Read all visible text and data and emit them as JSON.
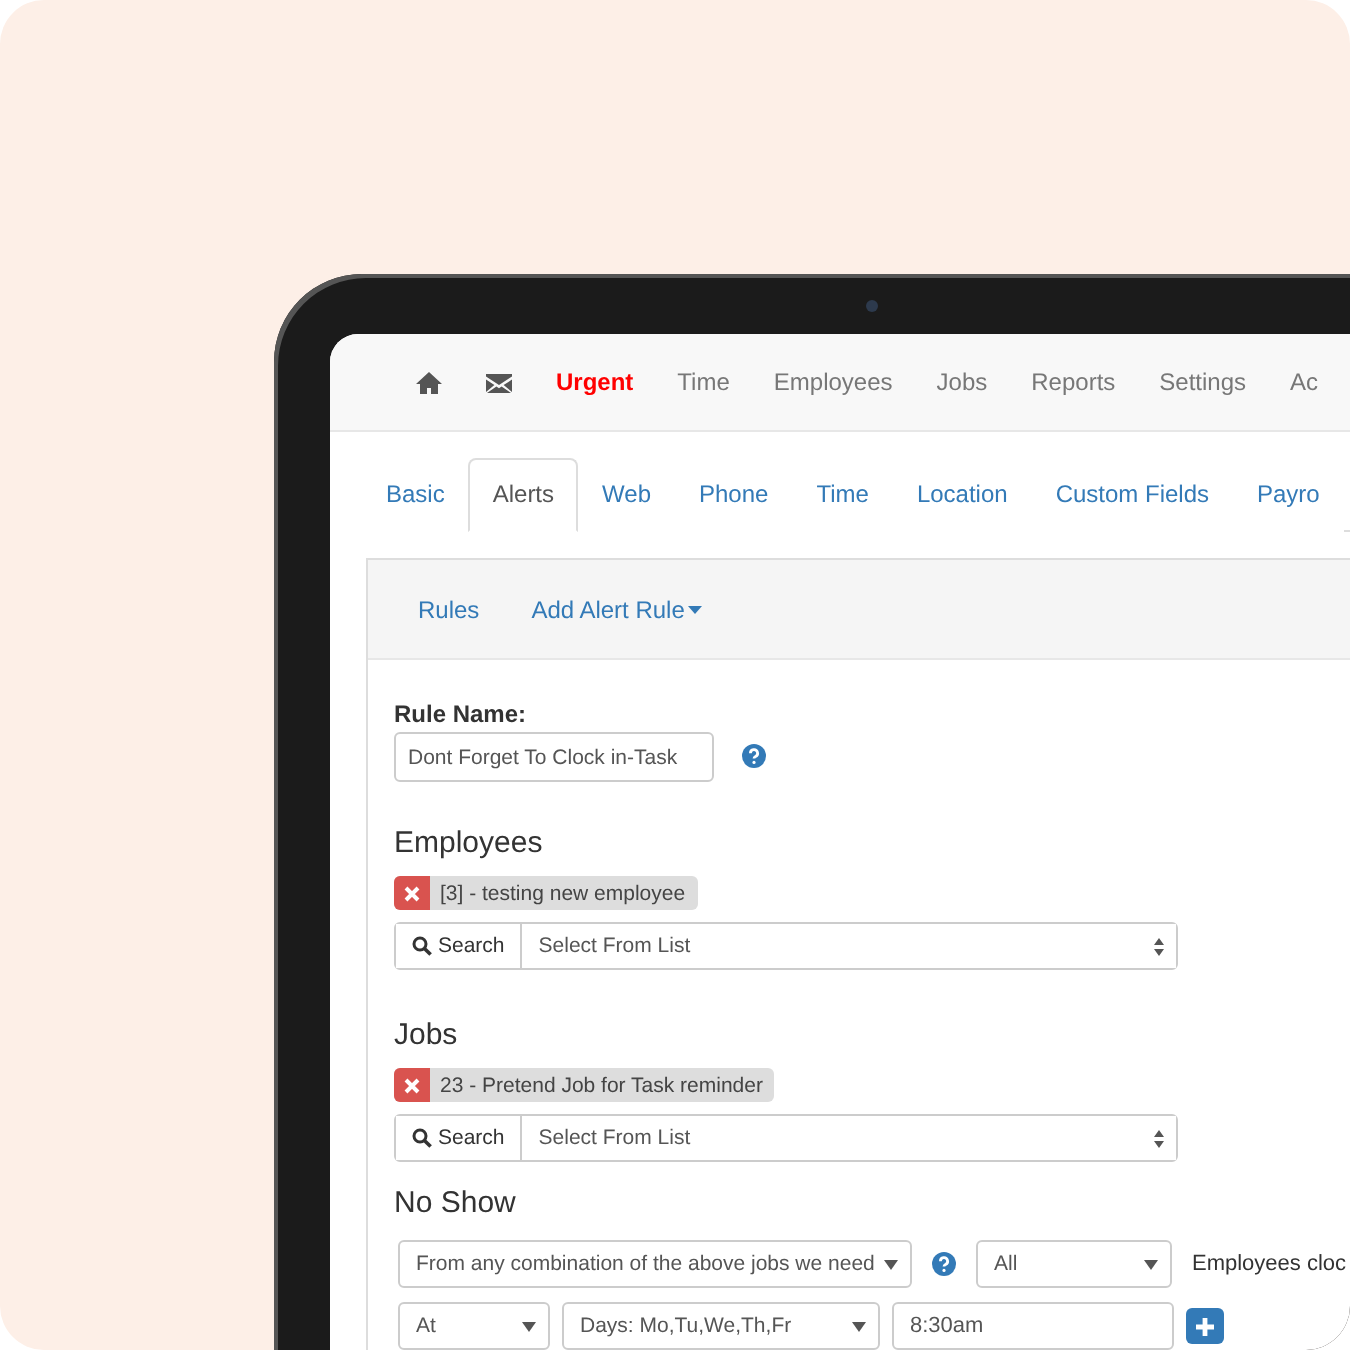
{
  "nav": {
    "items": [
      {
        "kind": "home",
        "highlighted": false
      },
      {
        "kind": "mail",
        "highlighted": false
      },
      {
        "kind": "text",
        "label": "Urgent",
        "highlighted": true
      },
      {
        "kind": "text",
        "label": "Time",
        "highlighted": false
      },
      {
        "kind": "text",
        "label": "Employees",
        "highlighted": false
      },
      {
        "kind": "text",
        "label": "Jobs",
        "highlighted": false
      },
      {
        "kind": "text",
        "label": "Reports",
        "highlighted": false
      },
      {
        "kind": "text",
        "label": "Settings",
        "highlighted": false
      },
      {
        "kind": "text",
        "label": "Ac",
        "highlighted": false
      }
    ]
  },
  "tabs": [
    {
      "label": "Basic",
      "selected": false
    },
    {
      "label": "Alerts",
      "selected": true
    },
    {
      "label": "Web",
      "selected": false
    },
    {
      "label": "Phone",
      "selected": false
    },
    {
      "label": "Time",
      "selected": false
    },
    {
      "label": "Location",
      "selected": false
    },
    {
      "label": "Custom Fields",
      "selected": false
    },
    {
      "label": "Payro",
      "selected": false
    }
  ],
  "subnav": [
    {
      "label": "Rules",
      "dropdown": false
    },
    {
      "label": "Add Alert Rule",
      "dropdown": true
    }
  ],
  "rule_name": {
    "label": "Rule Name:",
    "value": "Dont Forget To Clock in-Task"
  },
  "sections": [
    {
      "heading": "Employees",
      "tags": [
        "[3] - testing new employee"
      ],
      "search_button": "Search",
      "select": "Select From List"
    },
    {
      "heading": "Jobs",
      "tags": [
        "23 - Pretend Job for Task reminder"
      ],
      "search_button": "Search",
      "select": "Select From List"
    }
  ],
  "no_show": {
    "heading": "No Show",
    "rows": [
      [
        {
          "kind": "select",
          "value": "From any combination of the above jobs we need"
        },
        {
          "kind": "help"
        },
        {
          "kind": "select",
          "value": "All"
        },
        {
          "kind": "text",
          "value": "Employees cloc"
        }
      ],
      [
        {
          "kind": "select",
          "value": "At"
        },
        {
          "kind": "dropdown",
          "value": "Days: Mo,Tu,We,Th,Fr"
        },
        {
          "kind": "input",
          "value": "8:30am"
        },
        {
          "kind": "add"
        }
      ]
    ]
  }
}
